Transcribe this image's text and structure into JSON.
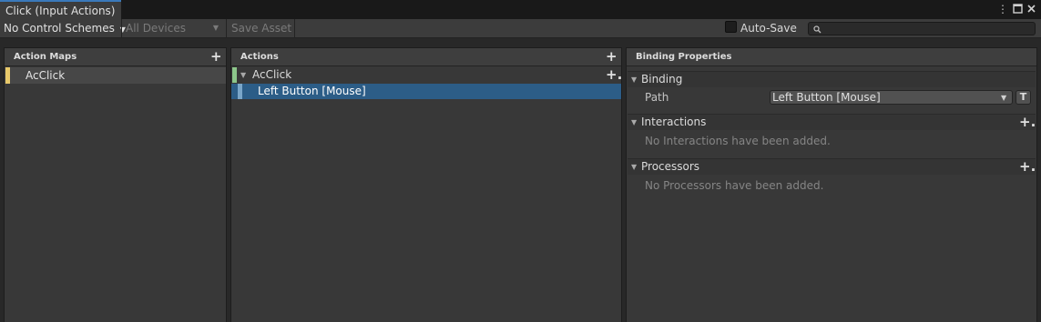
{
  "window": {
    "tab_title": "Click (Input Actions)",
    "menu_icon": "kebab-menu-icon",
    "maximize_icon": "maximize-icon",
    "close_icon": "close-icon"
  },
  "toolbar": {
    "control_schemes": "No Control Schemes",
    "devices": "All Devices",
    "save_asset": "Save Asset",
    "auto_save_label": "Auto-Save",
    "auto_save_checked": false,
    "search_value": ""
  },
  "action_maps": {
    "title": "Action Maps",
    "items": [
      {
        "label": "AcClick",
        "selected": true
      }
    ]
  },
  "actions": {
    "title": "Actions",
    "action": {
      "label": "AcClick"
    },
    "binding": {
      "label": "Left Button [Mouse]",
      "selected": true
    }
  },
  "properties": {
    "title": "Binding Properties",
    "binding_section": "Binding",
    "path_label": "Path",
    "path_value": "Left Button [Mouse]",
    "path_t_button": "T",
    "interactions_section": "Interactions",
    "interactions_empty": "No Interactions have been added.",
    "processors_section": "Processors",
    "processors_empty": "No Processors have been added."
  },
  "colors": {
    "accent_blue": "#3a79bb",
    "selection_blue": "#2c5d87",
    "map_marker": "#e8c96a",
    "action_marker": "#8cc68a",
    "binding_marker": "#7aa6c9"
  }
}
